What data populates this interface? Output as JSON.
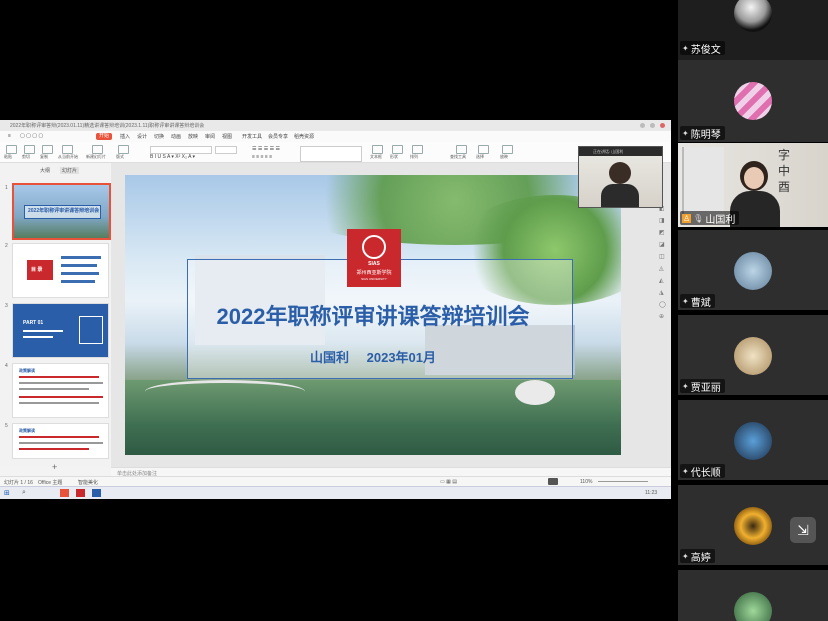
{
  "app": {
    "window_title": "2022年职称评审答辩(2023.01.11)精选讲课答辩培训(2023.1.11)职称评审讲课答辩培训会",
    "ribbon_tabs": [
      "文件",
      "开始",
      "插入",
      "设计",
      "切换",
      "动画",
      "放映",
      "审阅",
      "视图",
      "开发工具",
      "会员专享",
      "稻壳资源"
    ],
    "ribbon_groups": [
      "粘贴",
      "剪切",
      "复制",
      "格式刷",
      "从当前开始",
      "新建幻灯片",
      "版式",
      "节",
      "重置",
      "文本框",
      "形状",
      "排列",
      "替换",
      "查找工具",
      "选择",
      "放映"
    ],
    "left_tabs": [
      "大纲",
      "幻灯片"
    ],
    "notes_placeholder": "单击此处添加备注",
    "status": {
      "slide_count": "幻灯片 1 / 16",
      "theme": "Office 主题",
      "view_note": "智能美化",
      "zoom": "110%"
    },
    "taskbar_time": "11:23"
  },
  "slide": {
    "school_en": "SIAS",
    "school_name": "郑州西亚斯学院",
    "school_sub": "SIAS UNIVERSITY",
    "title": "2022年职称评审讲课答辩培训会",
    "presenter": "山国利",
    "date": "2023年01月"
  },
  "thumbs": [
    {
      "num": "1",
      "title": "2022年职称评审讲课答辩培训会"
    },
    {
      "num": "2",
      "title": "目 录"
    },
    {
      "num": "3",
      "title": "PART 01"
    },
    {
      "num": "4",
      "title": "政策解读"
    },
    {
      "num": "5",
      "title": "政策解读"
    }
  ],
  "popup": {
    "label": "正在讲话: 山国利"
  },
  "participants": [
    {
      "name": "苏俊文"
    },
    {
      "name": "陈明琴"
    },
    {
      "name": "山国利"
    },
    {
      "name": "曹斌"
    },
    {
      "name": "贾亚丽"
    },
    {
      "name": "代长顺"
    },
    {
      "name": "高婷"
    }
  ],
  "colors": {
    "slide_blue": "#2b5ea8",
    "logo_red": "#c9282c",
    "wps_red": "#e9523a"
  }
}
